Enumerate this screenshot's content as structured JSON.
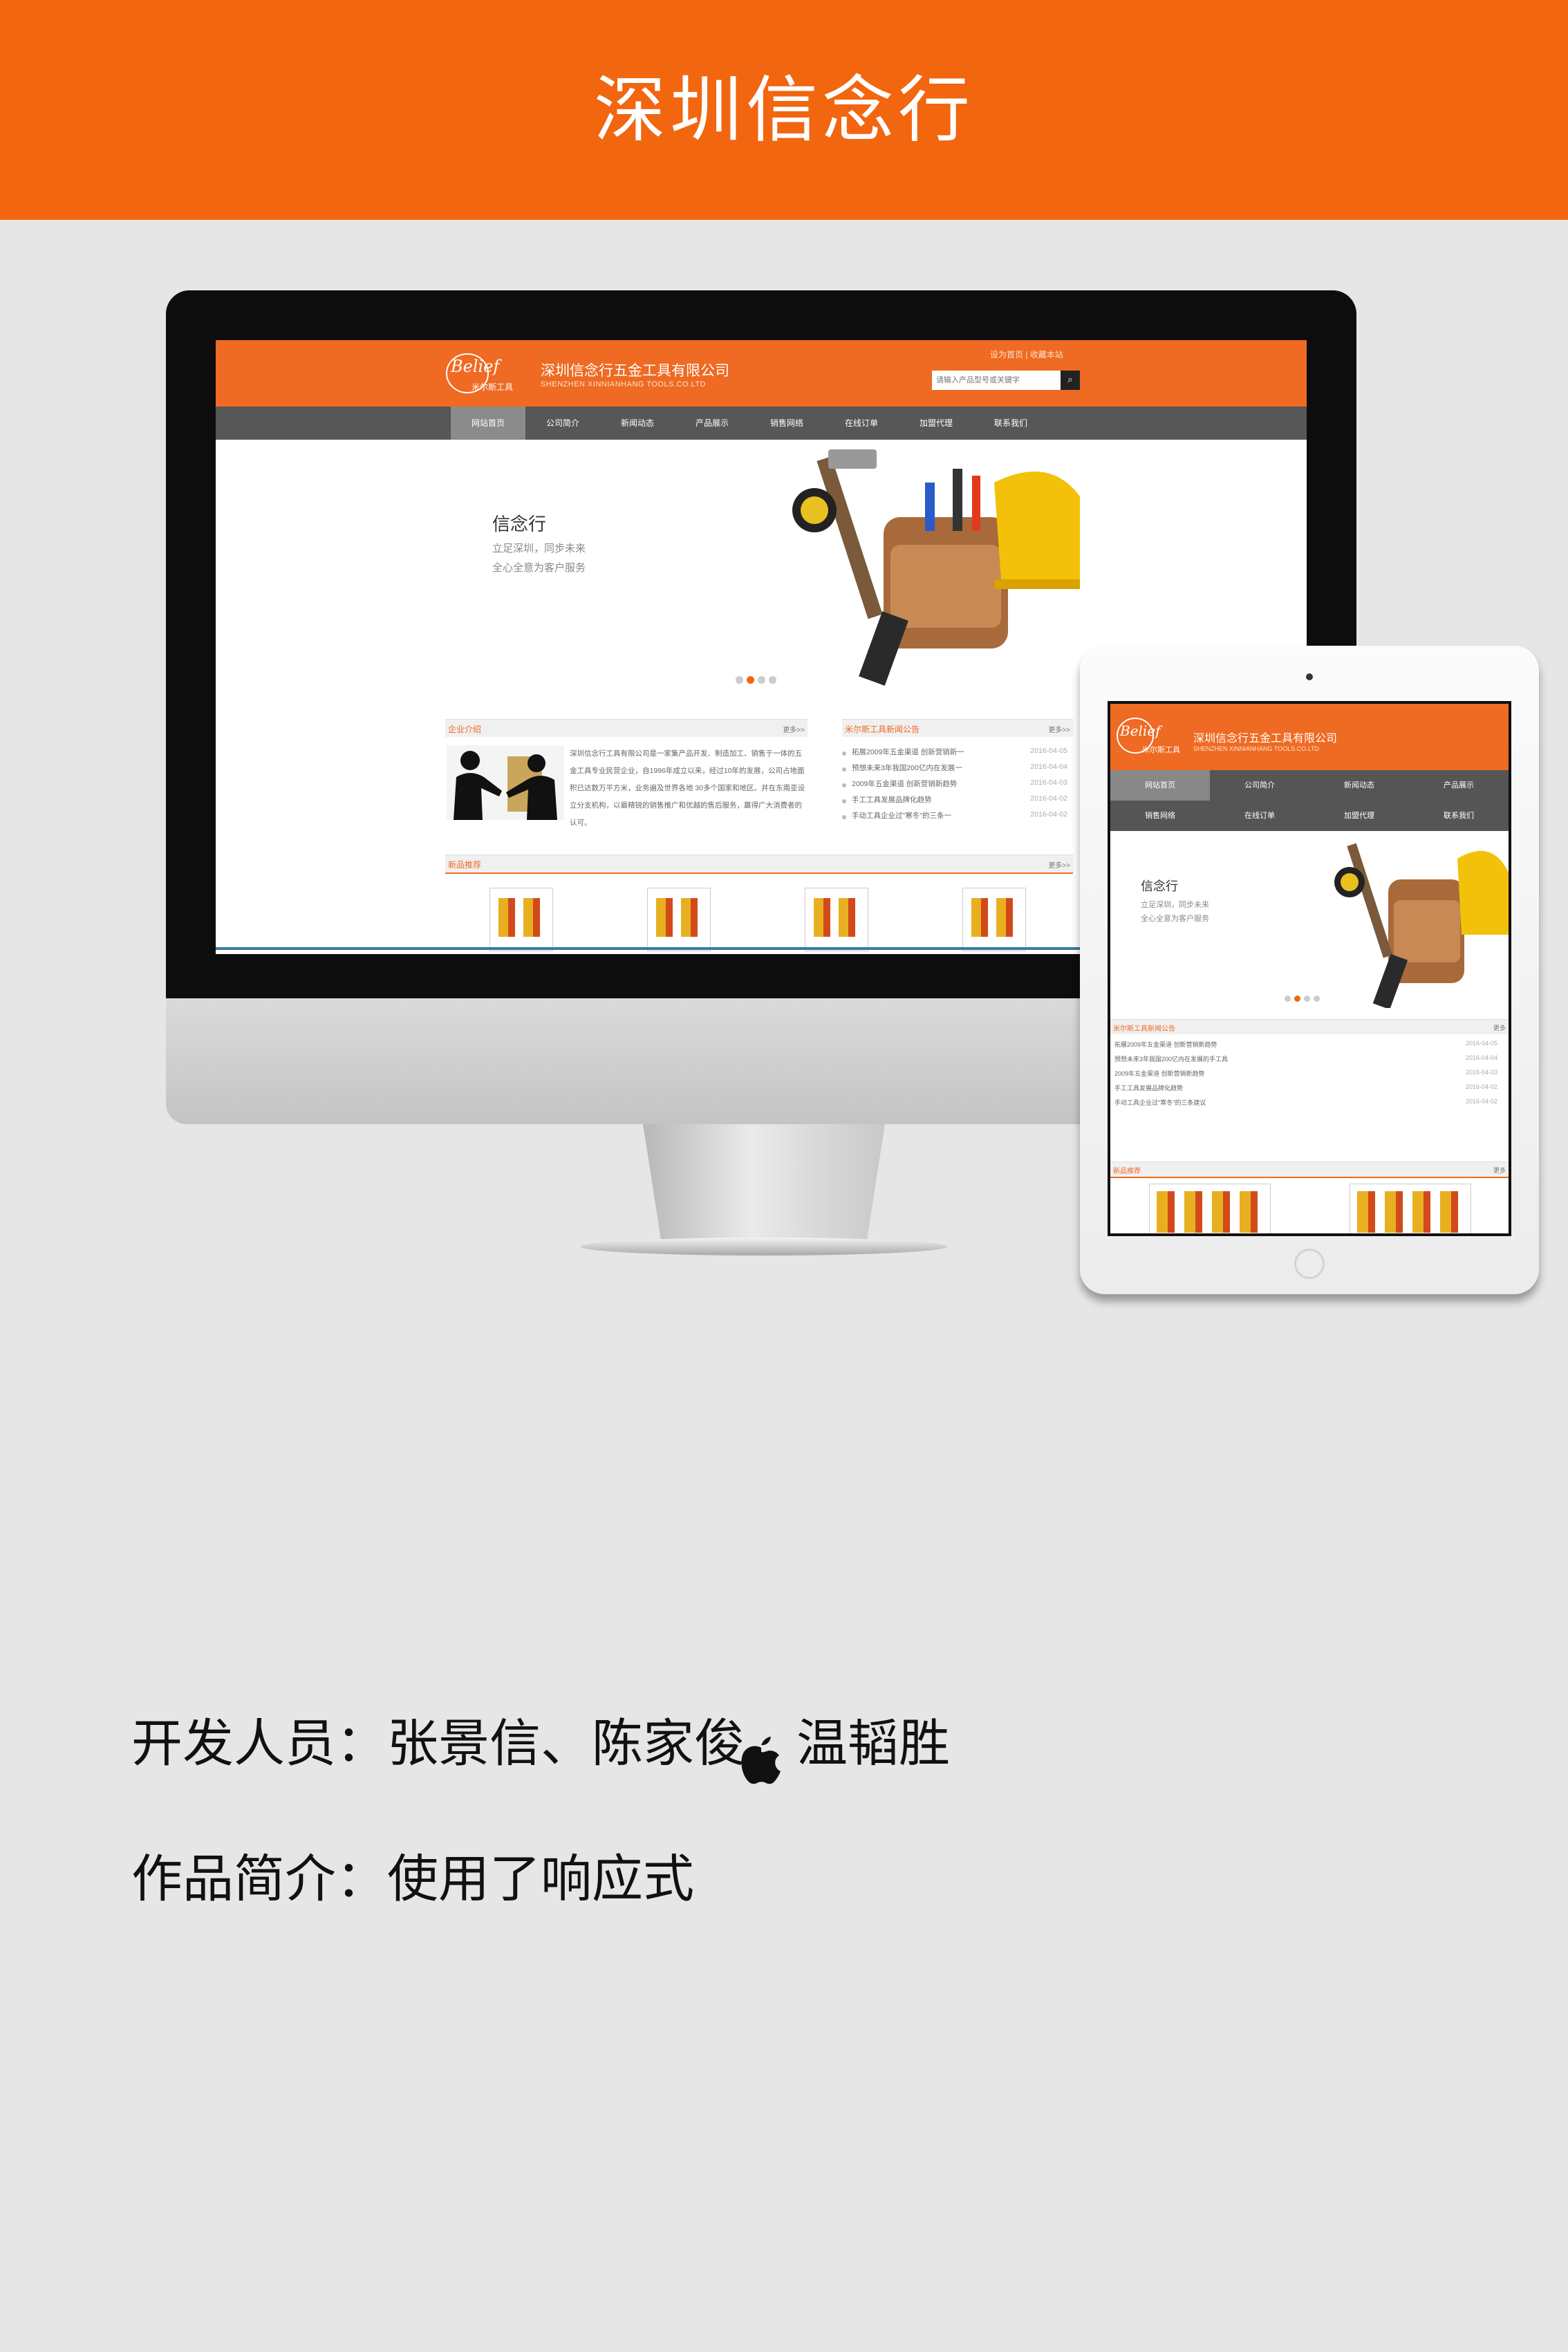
{
  "banner": {
    "title": "深圳信念行",
    "color": "#f26610"
  },
  "site": {
    "logo_text": "Belief",
    "logo_cn": "米尔斯工具",
    "company_name": "深圳信念行五金工具有限公司",
    "company_name_en": "SHENZHEN XINNIANHANG TOOLS.CO.LTD",
    "top_links": "设为首页 | 收藏本站",
    "search_placeholder": "请输入产品型号或关键字",
    "nav": [
      "网站首页",
      "公司简介",
      "新闻动态",
      "产品展示",
      "销售网络",
      "在线订单",
      "加盟代理",
      "联系我们"
    ],
    "hero": {
      "title": "信念行",
      "line1": "立足深圳，同步未来",
      "line2": "全心全意为客户服务"
    },
    "about": {
      "title": "企业介绍",
      "more": "更多>>",
      "text": "深圳信念行工具有限公司是一家集产品开发、制造加工、销售于一体的五金工具专业民营企业，自1996年成立以来，经过10年的发展，公司占地面积已达数万平方米，业务遍及世界各地 30多个国家和地区。并在东南亚设立分支机构，以最精锐的销售推广和优越的售后服务，赢得广大消费者的认可。"
    },
    "news": {
      "title": "米尔斯工具新闻公告",
      "more": "更多>>",
      "items": [
        {
          "text": "拓展2009年五金渠道 创新营销新一",
          "date": "2016-04-05"
        },
        {
          "text": "预想未来3年我国200亿内在发展一",
          "date": "2016-04-04"
        },
        {
          "text": "2009年五金渠道 创新营销新趋势",
          "date": "2016-04-03"
        },
        {
          "text": "手工工具发展品牌化趋势",
          "date": "2016-04-02"
        },
        {
          "text": "手动工具企业过\"寒冬\"的三条一",
          "date": "2016-04-02"
        }
      ]
    },
    "products": {
      "title": "新品推荐",
      "more": "更多>>"
    }
  },
  "tablet": {
    "news_title": "米尔斯工具新闻公告",
    "news_items": [
      {
        "text": "拓展2009年五金渠道 创新营销新趋势",
        "date": "2016-04-05"
      },
      {
        "text": "预想未来3年我国200亿内在发展的手工具",
        "date": "2016-04-04"
      },
      {
        "text": "2009年五金渠道 创新营销新趋势",
        "date": "2016-04-03"
      },
      {
        "text": "手工工具发展品牌化趋势",
        "date": "2016-04-02"
      },
      {
        "text": "手动工具企业过\"寒冬\"的三条建议",
        "date": "2016-04-02"
      }
    ],
    "products_title": "新品推荐",
    "more": "更多"
  },
  "captions": {
    "developers": "开发人员：张景信、陈家俊、温韬胜",
    "intro": "作品简介：使用了响应式"
  }
}
